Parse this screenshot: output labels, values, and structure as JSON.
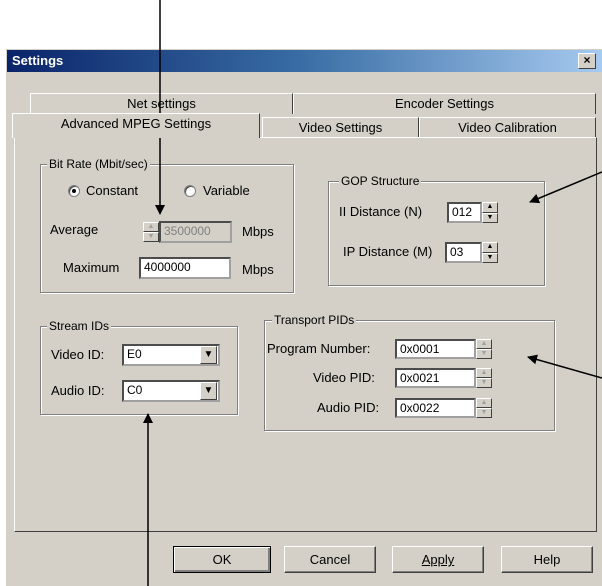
{
  "window": {
    "title": "Settings",
    "close_label": "×"
  },
  "tabs": {
    "row_back": [
      "Net settings",
      "Encoder Settings"
    ],
    "row_front": [
      "Advanced MPEG Settings",
      "Video Settings",
      "Video Calibration"
    ]
  },
  "bitrate": {
    "legend": "Bit Rate (Mbit/sec)",
    "constant_label": "Constant",
    "variable_label": "Variable",
    "selected": "Constant",
    "average_label": "Average",
    "average_value": "3500000",
    "average_unit": "Mbps",
    "maximum_label": "Maximum",
    "maximum_value": "4000000",
    "maximum_unit": "Mbps"
  },
  "gop": {
    "legend": "GOP Structure",
    "ii_label": "II Distance (N)",
    "ii_value": "012",
    "ip_label": "IP Distance (M)",
    "ip_value": "03"
  },
  "stream_ids": {
    "legend": "Stream IDs",
    "video_label": "Video ID:",
    "video_value": "E0",
    "audio_label": "Audio ID:",
    "audio_value": "C0"
  },
  "transport": {
    "legend": "Transport PIDs",
    "program_label": "Program Number:",
    "program_value": "0x0001",
    "video_label": "Video PID:",
    "video_value": "0x0021",
    "audio_label": "Audio PID:",
    "audio_value": "0x0022"
  },
  "buttons": {
    "ok": "OK",
    "cancel": "Cancel",
    "apply": "Apply",
    "help": "Help"
  },
  "icons": {
    "close": "close-icon",
    "spin_up": "spin-up-icon",
    "spin_down": "spin-down-icon",
    "dropdown": "chevron-down-icon"
  }
}
